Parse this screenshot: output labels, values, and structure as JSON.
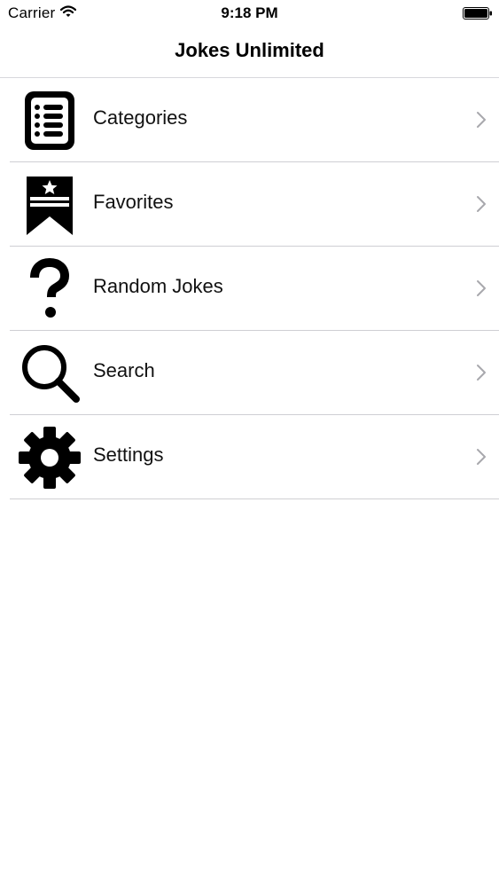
{
  "status_bar": {
    "carrier": "Carrier",
    "time": "9:18 PM"
  },
  "nav": {
    "title": "Jokes Unlimited"
  },
  "menu": {
    "items": [
      {
        "label": "Categories",
        "icon": "list-icon"
      },
      {
        "label": "Favorites",
        "icon": "bookmark-star-icon"
      },
      {
        "label": "Random Jokes",
        "icon": "question-mark-icon"
      },
      {
        "label": "Search",
        "icon": "search-icon"
      },
      {
        "label": "Settings",
        "icon": "gear-icon"
      }
    ]
  },
  "colors": {
    "background": "#ffffff",
    "separator": "#cfcfd3",
    "chevron": "#a8a8ad",
    "icon": "#000000"
  }
}
